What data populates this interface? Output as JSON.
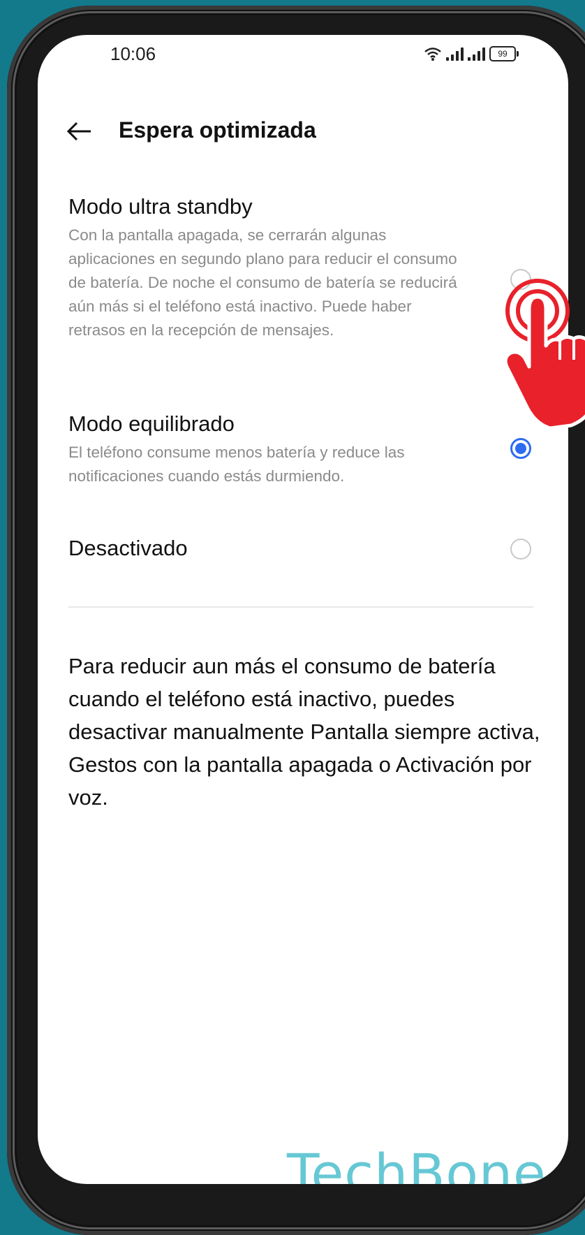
{
  "status_bar": {
    "time": "10:06",
    "battery": "99"
  },
  "header": {
    "title": "Espera optimizada"
  },
  "options": [
    {
      "title": "Modo ultra standby",
      "description": "Con la pantalla apagada, se cerrarán algunas aplicaciones en segundo plano para reducir el consumo de batería. De noche el consumo de batería se reducirá aún más si el teléfono está inactivo. Puede haber retrasos en la recepción de mensajes.",
      "selected": false
    },
    {
      "title": "Modo equilibrado",
      "description": "El teléfono consume menos batería y reduce las notificaciones cuando estás durmiendo.",
      "selected": true
    },
    {
      "title": "Desactivado",
      "description": "",
      "selected": false
    }
  ],
  "info_text": "Para reducir aun más el consumo de batería cuando el teléfono está inactivo, puedes desactivar manualmente Pantalla siempre activa, Gestos con la pantalla apagada o Activación por voz.",
  "watermark": "TechBone",
  "colors": {
    "background": "#137a8c",
    "accent": "#2d6cf0",
    "tap_indicator": "#e8212b",
    "watermark": "#66c8d4"
  }
}
